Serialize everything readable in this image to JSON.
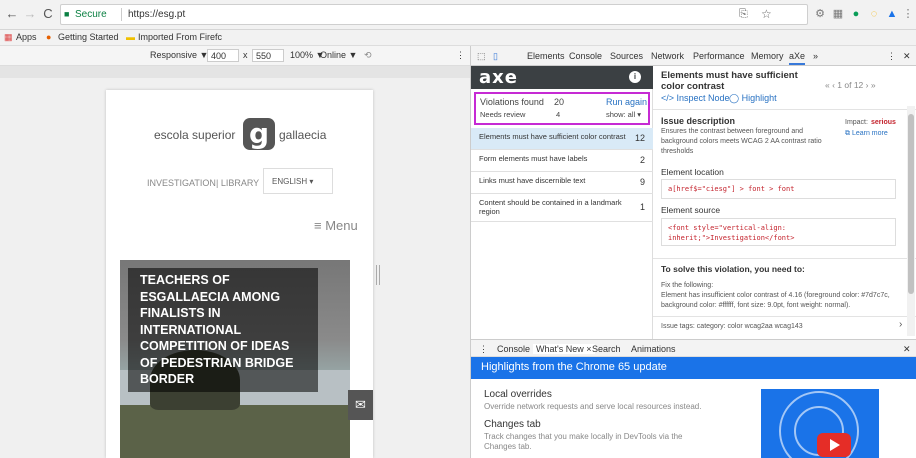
{
  "browser": {
    "secure_label": "Secure",
    "url": "https://esg.pt",
    "bookmarks": [
      "Apps",
      "Getting Started",
      "Imported From Firefc"
    ]
  },
  "device_toolbar": {
    "mode": "Responsive ▼",
    "width": "400",
    "times": "x",
    "height": "550",
    "zoom": "100% ▼",
    "network": "Online ▼"
  },
  "site": {
    "logo_left": "escola superior",
    "logo_letter": "g",
    "logo_right": "gallaecia",
    "nav_investigation": "INVESTIGATION",
    "nav_library": "| LIBRARY",
    "lang": "ENGLISH  ▾",
    "menu": "≡ Menu",
    "hero_title": "Teachers of ESGallaecia among finalists in International Competition of Ideas of Pedestrian Bridge Border",
    "mail_icon": "✉"
  },
  "devtools": {
    "tabs": [
      "Elements",
      "Console",
      "Sources",
      "Network",
      "Performance",
      "Memory",
      "aXe",
      "»"
    ],
    "axe": {
      "logo": "axe",
      "info_icon": "i",
      "violations_label": "Violations found",
      "violations_count": "20",
      "run_again": "Run again",
      "needs_review_label": "Needs review",
      "needs_review_count": "4",
      "show_filter": "show: all ▾",
      "issues": [
        {
          "label": "Elements must have sufficient color contrast",
          "count": "12"
        },
        {
          "label": "Form elements must have labels",
          "count": "2"
        },
        {
          "label": "Links must have discernible text",
          "count": "9"
        },
        {
          "label": "Content should be contained in a landmark region",
          "count": "1"
        }
      ],
      "detail": {
        "title": "Elements must have sufficient color contrast",
        "inspect": "</> Inspect Node",
        "highlight": "◯ Highlight",
        "pager": "«  ‹  1 of 12  ›  »",
        "issue_desc_h": "Issue description",
        "impact_label": "Impact:",
        "impact_value": "serious",
        "learn_more": "⧉ Learn more",
        "issue_desc": "Ensures the contrast between foreground and background colors meets WCAG 2 AA contrast ratio thresholds",
        "location_h": "Element location",
        "location_code": "a[href$=\"ciesg\"] > font > font",
        "source_h": "Element source",
        "source_code": "<font style=\"vertical-align: inherit;\">Investigation</font>",
        "solve_h": "To solve this violation, you need to:",
        "fix_h": "Fix the following:",
        "fix_text": "Element has insufficient color contrast of 4.16 (foreground color: #7d7c7c, background color: #ffffff, font size: 9.0pt, font weight: normal).",
        "tags": "Issue tags:   category: color   wcag2aa   wcag143"
      }
    },
    "drawer": {
      "tabs": [
        "Console",
        "What's New ×",
        "Search",
        "Animations"
      ],
      "banner": "Highlights from the Chrome 65 update",
      "items": [
        {
          "h": "Local overrides",
          "p": "Override network requests and serve local resources instead."
        },
        {
          "h": "Changes tab",
          "p": "Track changes that you make locally in DevTools via the Changes tab."
        }
      ]
    }
  },
  "colors": {
    "accent": "#1a73e8",
    "axe_header": "#3b4043",
    "summary_border": "#c62ad4",
    "impact_serious": "#c4232d"
  }
}
